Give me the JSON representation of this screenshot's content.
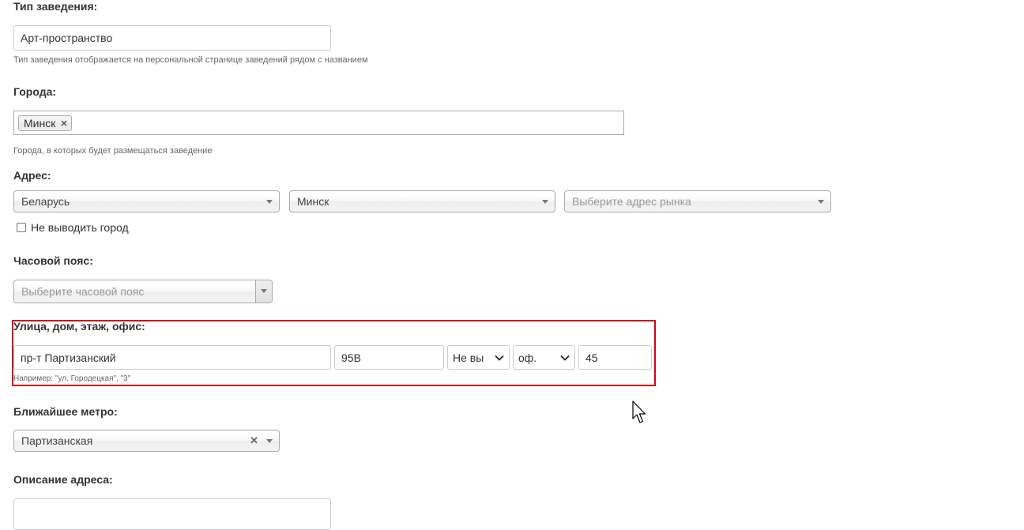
{
  "venue_type": {
    "label": "Тип заведения:",
    "value": "Арт-пространство",
    "hint": "Тип заведения отображается на персональной странице заведений рядом с названием"
  },
  "cities": {
    "label": "Города:",
    "tags": [
      "Минск"
    ],
    "remove_glyph": "✕",
    "hint": "Города, в которых будет размещаться заведение"
  },
  "address": {
    "label": "Адрес:",
    "country": "Беларусь",
    "city": "Минск",
    "market_placeholder": "Выберите адрес рынка",
    "hide_city_label": "Не выводить город",
    "hide_city_checked": false
  },
  "timezone": {
    "label": "Часовой пояс:",
    "placeholder": "Выберите часовой пояс"
  },
  "street": {
    "label": "Улица, дом, этаж, офис:",
    "street_value": "пр-т Партизанский",
    "house_value": "95В",
    "floor_select": "Не вы",
    "office_type_select": "оф.",
    "office_value": "45",
    "hint": "Например: \"ул. Городецкая\", \"3\"",
    "highlight_color": "#d0021b"
  },
  "metro": {
    "label": "Ближайшее метро:",
    "value": "Партизанская",
    "clear_glyph": "✕"
  },
  "address_description": {
    "label": "Описание адреса:"
  }
}
